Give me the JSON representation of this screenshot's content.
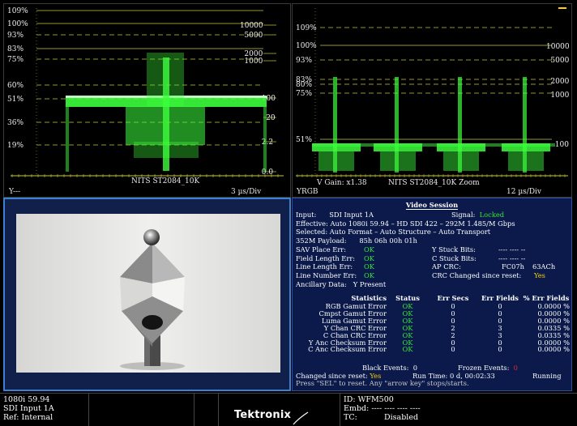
{
  "waveform_left": {
    "left_scale": [
      "109%",
      "100%",
      "93%",
      "83%",
      "75%",
      "60%",
      "51%",
      "36%",
      "19%"
    ],
    "right_scale": [
      "10000",
      "5000",
      "2000",
      "1000",
      "100",
      "20",
      "2.2",
      "0.0"
    ],
    "curve_label": "NITS ST2084_10K",
    "channel": "Y---",
    "timebase": "3 µs/Div",
    "trace_color": "#3cff3c",
    "graticule_color": "#c8c840"
  },
  "waveform_right": {
    "left_scale": [
      "109%",
      "100%",
      "93%",
      "83%",
      "80%",
      "75%",
      "51%"
    ],
    "right_scale": [
      "10000",
      "5000",
      "2000",
      "1000",
      "100"
    ],
    "curve_label": "NITS ST2084_10K Zoom",
    "gain": "V Gain: x1.38",
    "channel": "YRGB",
    "timebase": "12 µs/Div"
  },
  "session": {
    "title": "Video Session",
    "input_label": "Input:",
    "input_value": "SDI Input 1A",
    "signal_label": "Signal:",
    "signal_value": "Locked",
    "effective": "Effective:  Auto 1080i 59.94 – HD SDI 422 – 292M 1.485/M Gbps",
    "selected": "Selected:   Auto Format – Auto Structure – Auto Transport",
    "payload_label": "352M Payload:",
    "payload_value": "85h 06h 00h 01h",
    "sav_label": "SAV Place Err:",
    "sav_value": "OK",
    "field_len_label": "Field Length Err:",
    "field_len_value": "OK",
    "line_len_label": "Line Length Err:",
    "line_len_value": "OK",
    "line_num_label": "Line Number Err:",
    "line_num_value": "OK",
    "ancillary_label": "Ancillary Data:",
    "ancillary_value": "Y Present",
    "y_stuck_label": "Y Stuck Bits:",
    "y_stuck_value": "---- ---- --",
    "c_stuck_label": "C Stuck Bits:",
    "c_stuck_value": "---- ---- --",
    "ap_crc_label": "AP CRC:",
    "ap_crc_value_1": "FC07h",
    "ap_crc_value_2": "63ACh",
    "crc_changed_label": "CRC Changed since reset:",
    "crc_changed_value": "Yes",
    "stats_headers": [
      "Statistics",
      "Status",
      "Err Secs",
      "Err Fields",
      "% Err Fields"
    ],
    "stats_rows": [
      [
        "RGB Gamut Error",
        "OK",
        "0",
        "0",
        "0.0000 %"
      ],
      [
        "Cmpst Gamut Error",
        "OK",
        "0",
        "0",
        "0.0000 %"
      ],
      [
        "Luma Gamut Error",
        "OK",
        "0",
        "0",
        "0.0000 %"
      ],
      [
        "Y Chan CRC Error",
        "OK",
        "2",
        "3",
        "0.0335 %"
      ],
      [
        "C Chan CRC Error",
        "OK",
        "2",
        "3",
        "0.0335 %"
      ],
      [
        "Y Anc Checksum Error",
        "OK",
        "0",
        "0",
        "0.0000 %"
      ],
      [
        "C Anc Checksum Error",
        "OK",
        "0",
        "0",
        "0.0000 %"
      ]
    ],
    "black_events_label": "Black Events:",
    "black_events_value": "0",
    "frozen_events_label": "Frozen Events:",
    "frozen_events_value": "0",
    "changed_label": "Changed since reset:",
    "changed_value": "Yes",
    "runtime_label": "Run Time: 0 d, 00:02:33",
    "running": "Running",
    "help": "Press \"SEL\" to reset.  Any \"arrow key\" stops/starts."
  },
  "statusbar": {
    "format": "1080i 59.94",
    "input": "SDI Input 1A",
    "ref": "Ref: Internal",
    "brand": "Tektronix",
    "id": "ID: WFM500",
    "embd": "Embd: ---- ---- ---- ----",
    "tc_label": "TC:",
    "tc_value": "Disabled"
  }
}
